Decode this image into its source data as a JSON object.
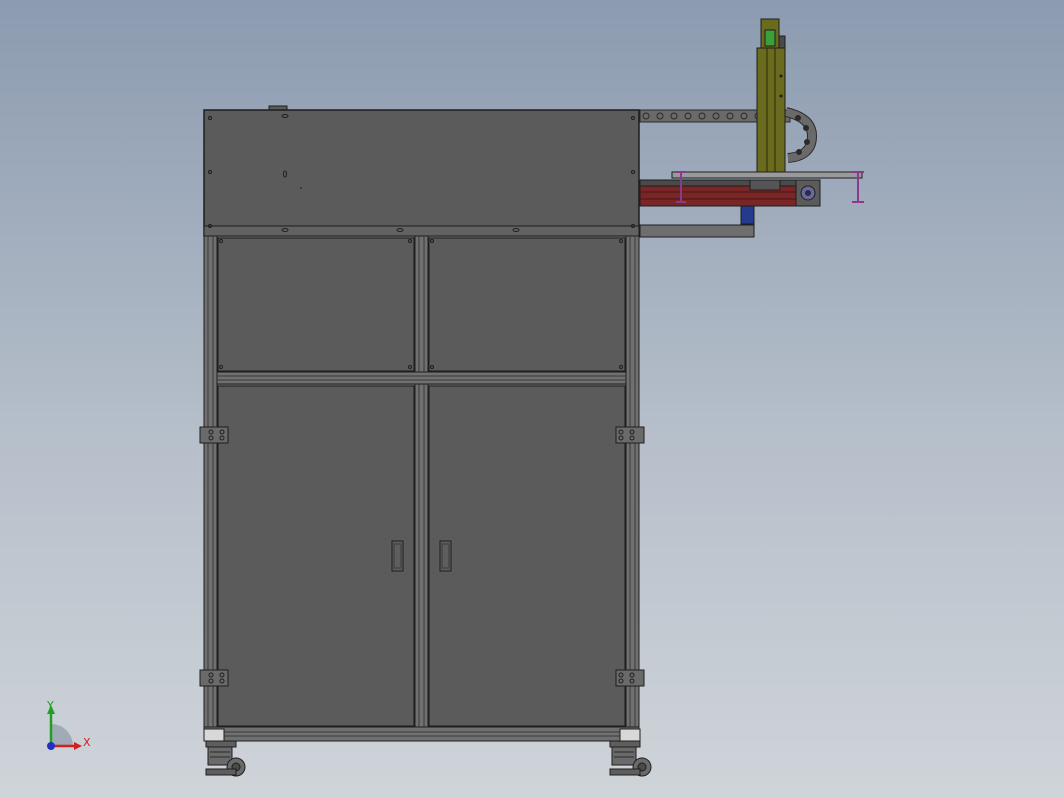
{
  "viewport": {
    "background_top": "#8c9bb0",
    "background_bottom": "#cfd4d9"
  },
  "model": {
    "panel_color": "#5b5b5b",
    "frame_color": "#6e6e6e",
    "edge_color": "#1e1e1e",
    "cylinder_color": "#6b6b1e",
    "rail_color": "#7a2626",
    "bracket_color": "#8a3a8a",
    "block_color": "#243a8c"
  },
  "triad": {
    "x_label": "X",
    "y_label": "Y",
    "x_color": "#d02020",
    "y_color": "#20a020",
    "z_color": "#2030c0"
  }
}
